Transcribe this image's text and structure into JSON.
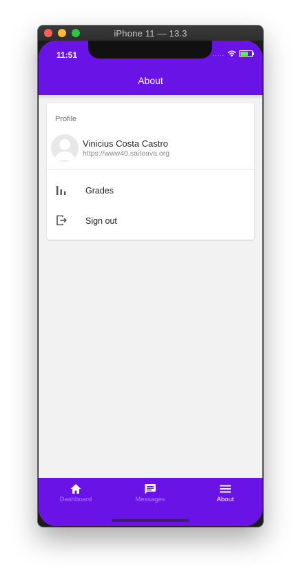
{
  "window": {
    "title": "iPhone 11 — 13.3"
  },
  "status_bar": {
    "time": "11:51",
    "signal_text": "....."
  },
  "header": {
    "title": "About"
  },
  "profile": {
    "section_label": "Profile",
    "name": "Vinicius Costa Castro",
    "url": "https://www40.saiteava.org"
  },
  "menu": {
    "items": [
      {
        "label": "Grades",
        "icon": "bar-chart-icon"
      },
      {
        "label": "Sign out",
        "icon": "sign-out-icon"
      }
    ]
  },
  "tabbar": {
    "tabs": [
      {
        "label": "Dashboard",
        "icon": "home-icon",
        "active": false
      },
      {
        "label": "Messages",
        "icon": "message-icon",
        "active": false
      },
      {
        "label": "About",
        "icon": "menu-icon",
        "active": true
      }
    ]
  },
  "colors": {
    "primary": "#6a13e6",
    "background": "#f2f2f2",
    "card": "#ffffff",
    "text": "#222222",
    "muted_text": "#8a8a8a"
  }
}
